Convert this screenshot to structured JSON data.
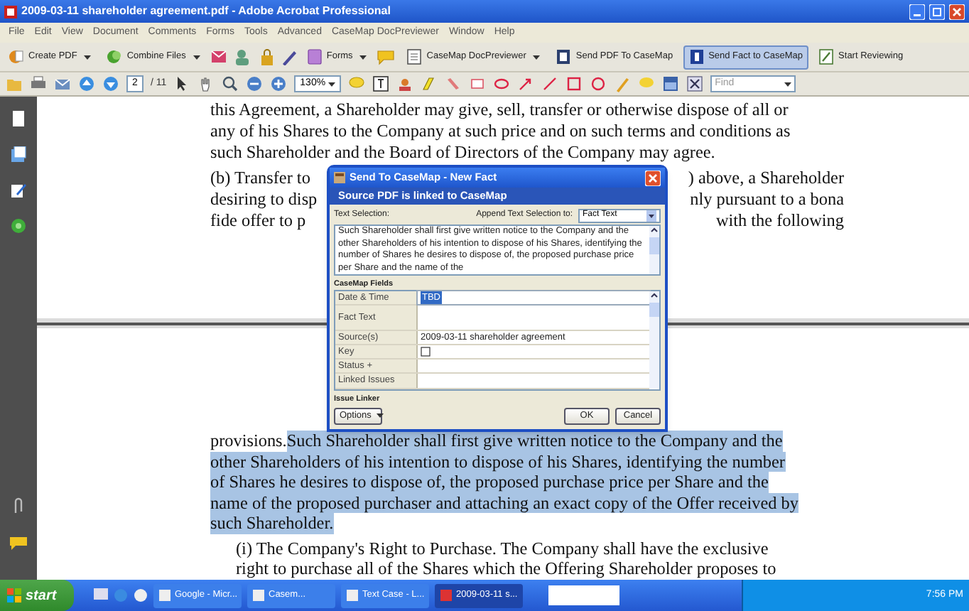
{
  "window": {
    "title": "2009-03-11 shareholder agreement.pdf - Adobe Acrobat Professional"
  },
  "menu": [
    "File",
    "Edit",
    "View",
    "Document",
    "Comments",
    "Forms",
    "Tools",
    "Advanced",
    "CaseMap DocPreviewer",
    "Window",
    "Help"
  ],
  "toolbar_1": [
    {
      "label": "Create PDF",
      "caret": true,
      "selected": false
    },
    {
      "label": "Combine Files",
      "caret": true,
      "selected": false
    },
    {
      "label": "Forms",
      "caret": true,
      "selected": false
    },
    {
      "label": "CaseMap DocPreviewer",
      "caret": true,
      "selected": false
    },
    {
      "label": "Send PDF To CaseMap",
      "caret": false,
      "selected": false
    },
    {
      "label": "Send Fact to CaseMap",
      "caret": false,
      "selected": true
    },
    {
      "label": "Start Reviewing",
      "caret": false,
      "selected": false
    }
  ],
  "toolbar_2": {
    "page_number": "2",
    "page_count": "/ 11",
    "zoom": "130%",
    "find_placeholder": "Find"
  },
  "page_1_lines": [
    {
      "left": "this Agreement, a Shareholder may give, sell, transfer or otherwise dispose of all or"
    },
    {
      "left": "any of his Shares to the Company at such price and on such terms and conditions as"
    },
    {
      "left": "such Shareholder and the Board of Directors of the Company may agree."
    },
    {
      "left": "(b) Transfer to",
      "right": ") above, a Shareholder"
    },
    {
      "left": "desiring to disp",
      "right": "nly pursuant to a bona"
    },
    {
      "left": "fide offer to p",
      "right": "with the following"
    }
  ],
  "page_2_paragraphs": [
    {
      "kind": "body",
      "lines": [
        [
          {
            "text": "provisions. ",
            "highlighted": false
          },
          {
            "text": "Such Shareholder shall first give written notice to the Company and the",
            "highlighted": true
          }
        ],
        [
          {
            "text": "other Shareholders of his intention to dispose of his Shares,  identifying the number",
            "highlighted": true
          }
        ],
        [
          {
            "text": "of Shares he desires to dispose of, the proposed purchase price per Share and the",
            "highlighted": true
          }
        ],
        [
          {
            "text": "name of the proposed purchaser and attaching an exact copy of the Offer received by",
            "highlighted": true
          }
        ],
        [
          {
            "text": "such Shareholder.",
            "highlighted": true
          }
        ]
      ]
    },
    {
      "kind": "item",
      "lines": [
        [
          {
            "text": "(i) The Company's Right to Purchase.  The Company shall have the exclusive",
            "highlighted": false
          }
        ],
        [
          {
            "text": "right to purchase all  of the Shares which the Offering Shareholder proposes to",
            "highlighted": false
          }
        ]
      ]
    }
  ],
  "dialog": {
    "title": "Send To CaseMap - New Fact",
    "subtitle": "Source PDF is linked to CaseMap",
    "text_selection_label": "Text Selection:",
    "append_label": "Append Text Selection to:",
    "append_value": "Fact Text",
    "selection_text": "Such Shareholder shall first give written notice to the Company and the other Shareholders of his intention to dispose of his Shares, identifying the number of Shares he desires to dispose of, the proposed purchase price per Share and the name of the",
    "fields_heading": "CaseMap Fields",
    "fields": [
      {
        "label": "Date & Time",
        "kind": "text",
        "value": "TBD",
        "selected": true
      },
      {
        "label": "Fact Text",
        "kind": "tall",
        "selected": false
      },
      {
        "label": "Source(s)",
        "kind": "text",
        "value": "2009-03-11 shareholder agreement",
        "selected": false
      },
      {
        "label": "Key",
        "kind": "checkbox",
        "checked": false,
        "selected": false
      },
      {
        "label": "Status +",
        "kind": "text",
        "selected": false
      },
      {
        "label": "Linked Issues",
        "kind": "text",
        "selected": false
      }
    ],
    "issue_heading": "Issue Linker",
    "buttons": [
      {
        "label": "Options",
        "kind": "menu"
      },
      {
        "label": "OK",
        "kind": "plain"
      },
      {
        "label": "Cancel",
        "kind": "plain"
      }
    ]
  },
  "taskbar": {
    "start": "start",
    "tasks": [
      {
        "label": "Google - Micr...",
        "selected": false
      },
      {
        "label": "Casem...",
        "selected": false
      },
      {
        "label": "Text Case - L...",
        "selected": false
      },
      {
        "label": "2009-03-11 s...",
        "selected": true
      }
    ],
    "clock": "7:56 PM"
  }
}
